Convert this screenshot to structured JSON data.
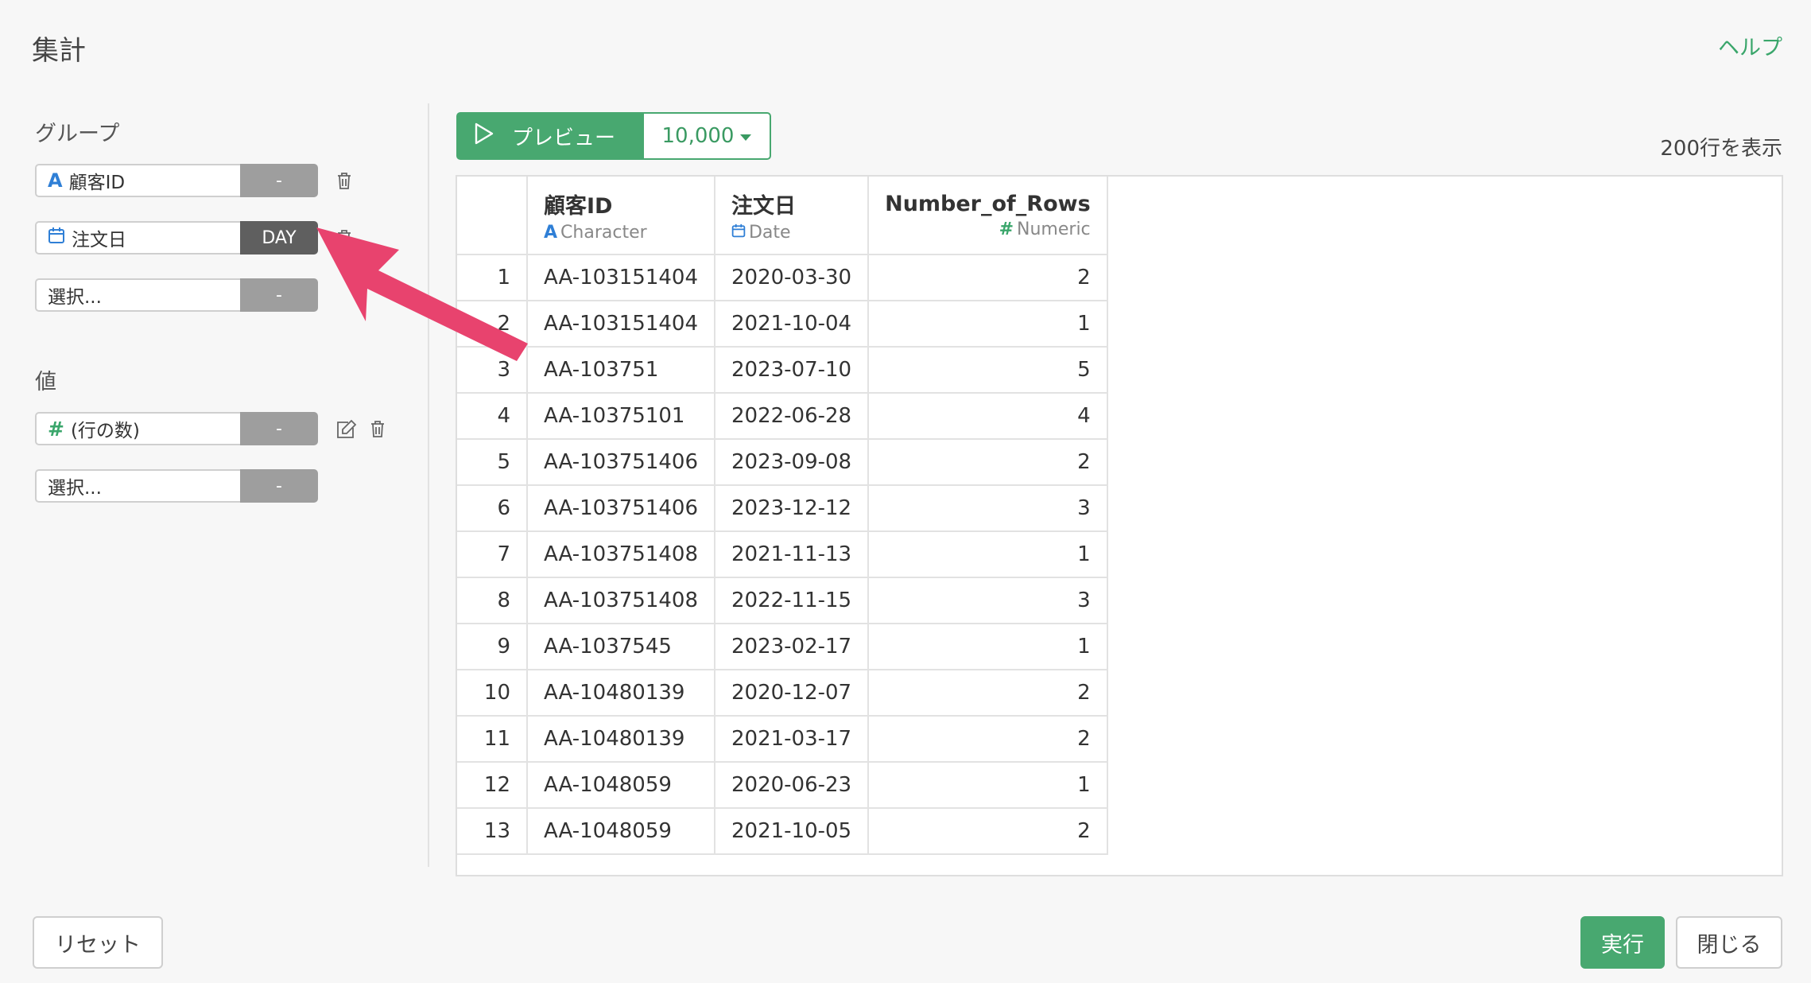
{
  "dialog": {
    "title": "集計",
    "help_label": "ヘルプ"
  },
  "group": {
    "label": "グループ",
    "fields": [
      {
        "icon": "character-icon",
        "name": "顧客ID",
        "modifier": "-"
      },
      {
        "icon": "calendar-icon",
        "name": "注文日",
        "modifier": "DAY"
      }
    ],
    "select_placeholder": "選択...",
    "select_modifier": "-"
  },
  "values": {
    "label": "値",
    "fields": [
      {
        "icon": "hash-icon",
        "name": "(行の数)",
        "modifier": "-"
      }
    ],
    "select_placeholder": "選択...",
    "select_modifier": "-"
  },
  "preview": {
    "button_label": "プレビュー",
    "limit": "10,000",
    "rows_shown": "200行を表示"
  },
  "table": {
    "columns": [
      {
        "name": "顧客ID",
        "type_icon": "A",
        "type": "Character"
      },
      {
        "name": "注文日",
        "type_icon": "calendar-icon",
        "type": "Date"
      },
      {
        "name": "Number_of_Rows",
        "type_icon": "#",
        "type": "Numeric"
      }
    ],
    "rows": [
      [
        "1",
        "AA-103151404",
        "2020-03-30",
        "2"
      ],
      [
        "2",
        "AA-103151404",
        "2021-10-04",
        "1"
      ],
      [
        "3",
        "AA-103751",
        "2023-07-10",
        "5"
      ],
      [
        "4",
        "AA-10375101",
        "2022-06-28",
        "4"
      ],
      [
        "5",
        "AA-103751406",
        "2023-09-08",
        "2"
      ],
      [
        "6",
        "AA-103751406",
        "2023-12-12",
        "3"
      ],
      [
        "7",
        "AA-103751408",
        "2021-11-13",
        "1"
      ],
      [
        "8",
        "AA-103751408",
        "2022-11-15",
        "3"
      ],
      [
        "9",
        "AA-1037545",
        "2023-02-17",
        "1"
      ],
      [
        "10",
        "AA-10480139",
        "2020-12-07",
        "2"
      ],
      [
        "11",
        "AA-10480139",
        "2021-03-17",
        "2"
      ],
      [
        "12",
        "AA-1048059",
        "2020-06-23",
        "1"
      ],
      [
        "13",
        "AA-1048059",
        "2021-10-05",
        "2"
      ]
    ]
  },
  "footer": {
    "reset_label": "リセット",
    "run_label": "実行",
    "close_label": "閉じる"
  },
  "colors": {
    "accent": "#48a870",
    "annotation_arrow": "#e8436e"
  }
}
